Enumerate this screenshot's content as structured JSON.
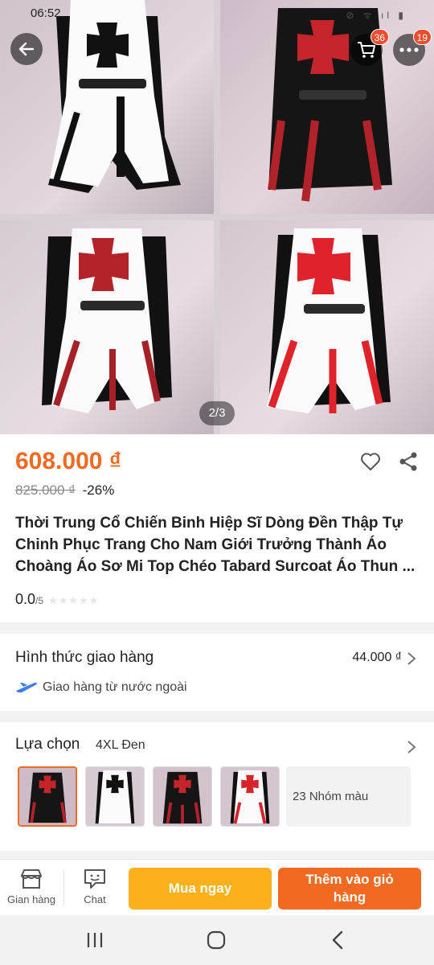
{
  "status_bar": {
    "time": "06:52",
    "icons": "⊘ ᯤ ıl ▮"
  },
  "gallery": {
    "indicator": "2/3"
  },
  "header": {
    "cart_badge": "36",
    "more_badge": "19"
  },
  "product": {
    "price": "608.000 ₫",
    "original_price": "825.000 ₫",
    "discount": "-26%",
    "title": "Thời Trung Cổ Chiến Binh Hiệp Sĩ Dòng Đền Thập Tự Chinh Phục Trang Cho Nam Giới Trưởng Thành Áo Choàng Áo Sơ Mi Top Chéo Tabard Surcoat Áo Thun ...",
    "rating": "0.0",
    "rating_max": "/5",
    "stars": "★★★★★"
  },
  "shipping": {
    "label": "Hình thức giao hàng",
    "fee": "44.000 ₫",
    "method": "Giao hàng từ nước ngoài"
  },
  "options": {
    "label": "Lựa chọn",
    "selected": "4XL Đen",
    "more_colors": "23 Nhóm màu"
  },
  "action_bar": {
    "store": "Gian hàng",
    "chat": "Chat",
    "buy_now": "Mua ngay",
    "add_to_cart": "Thêm vào giỏ hàng"
  },
  "colors": {
    "accent": "#f26a21",
    "buy": "#fbb11b",
    "badge": "#ee4d2d"
  }
}
